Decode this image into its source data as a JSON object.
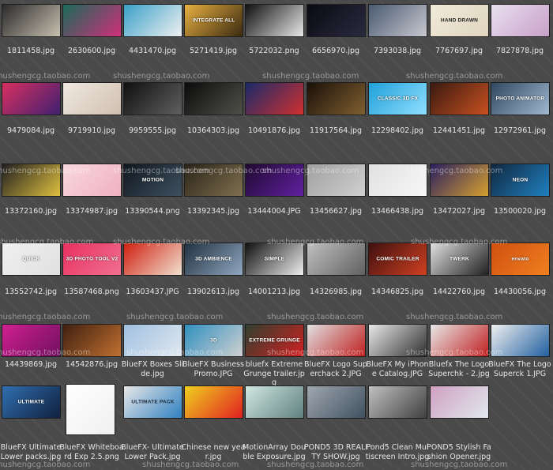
{
  "watermark_text": "shushengcg.taobao.com",
  "rows": [
    {
      "items": [
        {
          "label": "1811458.jpg",
          "colors": [
            "#2a2a2a",
            "#c8c0b0"
          ],
          "text": "",
          "text_color": "#ffffff"
        },
        {
          "label": "2630600.jpg",
          "colors": [
            "#1a6a5a",
            "#d0307a"
          ],
          "text": "",
          "text_color": "#ffffff"
        },
        {
          "label": "4431470.jpg",
          "colors": [
            "#3aa0c8",
            "#f0f0f0"
          ],
          "text": "",
          "text_color": "#ffffff"
        },
        {
          "label": "5271419.jpg",
          "colors": [
            "#e8b040",
            "#3a2a10"
          ],
          "text": "INTEGRATE ALL",
          "text_color": "#ffffff"
        },
        {
          "label": "5722032.png",
          "colors": [
            "#101010",
            "#e8e8e8"
          ],
          "text": "",
          "text_color": "#ffffff"
        },
        {
          "label": "6656970.jpg",
          "colors": [
            "#0a0a12",
            "#2a2a40"
          ],
          "text": "",
          "text_color": "#ffffff"
        },
        {
          "label": "7393038.jpg",
          "colors": [
            "#4a5a70",
            "#c8c8d0"
          ],
          "text": "",
          "text_color": "#ffffff"
        },
        {
          "label": "7767697.jpg",
          "colors": [
            "#f0ead8",
            "#e0d6c0"
          ],
          "text": "HAND DRAWN",
          "text_color": "#202020"
        },
        {
          "label": "7827878.jpg",
          "colors": [
            "#e8e0f0",
            "#c8a0c8"
          ],
          "text": "",
          "text_color": "#ffffff"
        }
      ]
    },
    {
      "items": [
        {
          "label": "9479084.jpg",
          "colors": [
            "#d83060",
            "#402070"
          ],
          "text": "",
          "text_color": "#ffffff"
        },
        {
          "label": "9719910.jpg",
          "colors": [
            "#f0e8e0",
            "#d0c0b0"
          ],
          "text": "",
          "text_color": "#ffffff"
        },
        {
          "label": "9959555.jpg",
          "colors": [
            "#101010",
            "#606060"
          ],
          "text": "",
          "text_color": "#ffffff"
        },
        {
          "label": "10364303.jpg",
          "colors": [
            "#0a0a0a",
            "#50504a"
          ],
          "text": "",
          "text_color": "#ffffff"
        },
        {
          "label": "10491876.jpg",
          "colors": [
            "#1a2a6a",
            "#d03030"
          ],
          "text": "",
          "text_color": "#ffffff"
        },
        {
          "label": "11917564.jpg",
          "colors": [
            "#1a1008",
            "#806030"
          ],
          "text": "",
          "text_color": "#ffffff"
        },
        {
          "label": "12298402.jpg",
          "colors": [
            "#20a0d8",
            "#90e0ff"
          ],
          "text": "CLASSIC 3D FX",
          "text_color": "#ffffff"
        },
        {
          "label": "12441451.jpg",
          "colors": [
            "#3a1a10",
            "#c85020"
          ],
          "text": "",
          "text_color": "#ffffff"
        },
        {
          "label": "12972961.jpg",
          "colors": [
            "#304860",
            "#a0b8d0"
          ],
          "text": "PHOTO ANIMATOR",
          "text_color": "#ffffff"
        }
      ]
    },
    {
      "items": [
        {
          "label": "13372160.jpg",
          "colors": [
            "#202020",
            "#e0c040"
          ],
          "text": "",
          "text_color": "#ffffff"
        },
        {
          "label": "13374987.jpg",
          "colors": [
            "#f8d8e0",
            "#f0b0c0"
          ],
          "text": "",
          "text_color": "#ffffff"
        },
        {
          "label": "13390544.png",
          "colors": [
            "#101820",
            "#405060"
          ],
          "text": "MOTION",
          "text_color": "#ffffff"
        },
        {
          "label": "13392345.jpg",
          "colors": [
            "#2a2418",
            "#807050"
          ],
          "text": "",
          "text_color": "#ffffff"
        },
        {
          "label": "13444004.JPG",
          "colors": [
            "#200a30",
            "#6020a0"
          ],
          "text": "",
          "text_color": "#ffffff"
        },
        {
          "label": "13456627.jpg",
          "colors": [
            "#a0a0a0",
            "#d0d0d0"
          ],
          "text": "",
          "text_color": "#ffffff"
        },
        {
          "label": "13466438.jpg",
          "colors": [
            "#e0e0e0",
            "#f8f8f8"
          ],
          "text": "",
          "text_color": "#ffffff"
        },
        {
          "label": "13472027.jpg",
          "colors": [
            "#2a2060",
            "#d8a030"
          ],
          "text": "",
          "text_color": "#ffffff"
        },
        {
          "label": "13500020.jpg",
          "colors": [
            "#102840",
            "#2080c0"
          ],
          "text": "NEON",
          "text_color": "#ffffff"
        }
      ]
    },
    {
      "items": [
        {
          "label": "13552742.jpg",
          "colors": [
            "#f0f0f0",
            "#e0e0e0"
          ],
          "text": "QUICK",
          "text_color": "#ffffff"
        },
        {
          "label": "13587468.png",
          "colors": [
            "#e83060",
            "#f07090"
          ],
          "text": "3D PHOTO TOOL V2",
          "text_color": "#ffffff"
        },
        {
          "label": "13603437.JPG",
          "colors": [
            "#d02010",
            "#f0e0d0"
          ],
          "text": "",
          "text_color": "#ffffff"
        },
        {
          "label": "13902613.jpg",
          "colors": [
            "#203040",
            "#90a8c0"
          ],
          "text": "3D AMBIENCE",
          "text_color": "#ffffff"
        },
        {
          "label": "14001213.jpg",
          "colors": [
            "#101010",
            "#f0f0f0"
          ],
          "text": "SIMPLE",
          "text_color": "#ffffff"
        },
        {
          "label": "14326985.jpg",
          "colors": [
            "#c0c0c0",
            "#606060"
          ],
          "text": "",
          "text_color": "#ffffff"
        },
        {
          "label": "14346825.jpg",
          "colors": [
            "#401010",
            "#d04020"
          ],
          "text": "COMIC TRAILER",
          "text_color": "#ffffff"
        },
        {
          "label": "14422760.jpg",
          "colors": [
            "#e0e0e0",
            "#202020"
          ],
          "text": "TWERK",
          "text_color": "#ffffff"
        },
        {
          "label": "14430056.jpg",
          "colors": [
            "#d05010",
            "#f08020"
          ],
          "text": "envato",
          "text_color": "#ffffff"
        }
      ]
    },
    {
      "items": [
        {
          "label": "14439869.jpg",
          "colors": [
            "#d02090",
            "#701060"
          ],
          "text": "",
          "text_color": "#ffffff"
        },
        {
          "label": "14542876.jpg",
          "colors": [
            "#402010",
            "#c07030"
          ],
          "text": "",
          "text_color": "#ffffff"
        },
        {
          "label": "BlueFX Boxes Slide.jpg",
          "colors": [
            "#a0c0e0",
            "#e0e8f0"
          ],
          "text": "",
          "text_color": "#ffffff"
        },
        {
          "label": "BlueFX Business Promo.JPG",
          "colors": [
            "#3090c0",
            "#d0d0d0"
          ],
          "text": "3D",
          "text_color": "#ffffff"
        },
        {
          "label": "bluefx Extreme Grunge trailer.jpg",
          "colors": [
            "#304030",
            "#d02020"
          ],
          "text": "EXTREME GRUNGE",
          "text_color": "#ffffff"
        },
        {
          "label": "BlueFX Logo Superchack 2.JPG",
          "colors": [
            "#e0e0e0",
            "#c02020"
          ],
          "text": "",
          "text_color": "#ffffff"
        },
        {
          "label": "BlueFX My iPhone Catalog.JPG",
          "colors": [
            "#e8e8e8",
            "#303030"
          ],
          "text": "",
          "text_color": "#ffffff"
        },
        {
          "label": "Bluefx The Logo Superchk - 2.jpg",
          "colors": [
            "#e8e8e8",
            "#c02020"
          ],
          "text": "",
          "text_color": "#ffffff"
        },
        {
          "label": "BlueFX The Logo Superck 1.JPG",
          "colors": [
            "#f0f0f0",
            "#2060a0"
          ],
          "text": "",
          "text_color": "#ffffff"
        }
      ]
    },
    {
      "items": [
        {
          "label": "BlueFX Ultimate Lower packs.jpg",
          "colors": [
            "#3070b0",
            "#102040"
          ],
          "text": "ULTIMATE",
          "text_color": "#ffffff"
        },
        {
          "label": "BlueFX Whiteboard Exp 2.5.png",
          "colors": [
            "#ffffff",
            "#f0f0f0"
          ],
          "text": "",
          "text_color": "#202020",
          "tall": true
        },
        {
          "label": "BlueFX- Ultimate Lower Pack.jpg",
          "colors": [
            "#e8e8e8",
            "#3080c0"
          ],
          "text": "ULTIMATE PACK",
          "text_color": "#203040"
        },
        {
          "label": "Chinese new year.jpg",
          "colors": [
            "#f0d020",
            "#e02020"
          ],
          "text": "",
          "text_color": "#ffffff"
        },
        {
          "label": "MotionArray Double Exposure.jpg",
          "colors": [
            "#d0e8e0",
            "#608080"
          ],
          "text": "",
          "text_color": "#ffffff"
        },
        {
          "label": "POND5 3D REALITY SHOW.jpg",
          "colors": [
            "#a0a8b0",
            "#405060"
          ],
          "text": "",
          "text_color": "#ffffff"
        },
        {
          "label": "Pond5 Clean Multiscreen Intro.jpg",
          "colors": [
            "#c0c0c0",
            "#404040"
          ],
          "text": "",
          "text_color": "#ffffff"
        },
        {
          "label": "POND5 Stylish Fashion Opener.jpg",
          "colors": [
            "#d0a0c0",
            "#e0e8f0"
          ],
          "text": "",
          "text_color": "#ffffff"
        }
      ]
    }
  ]
}
